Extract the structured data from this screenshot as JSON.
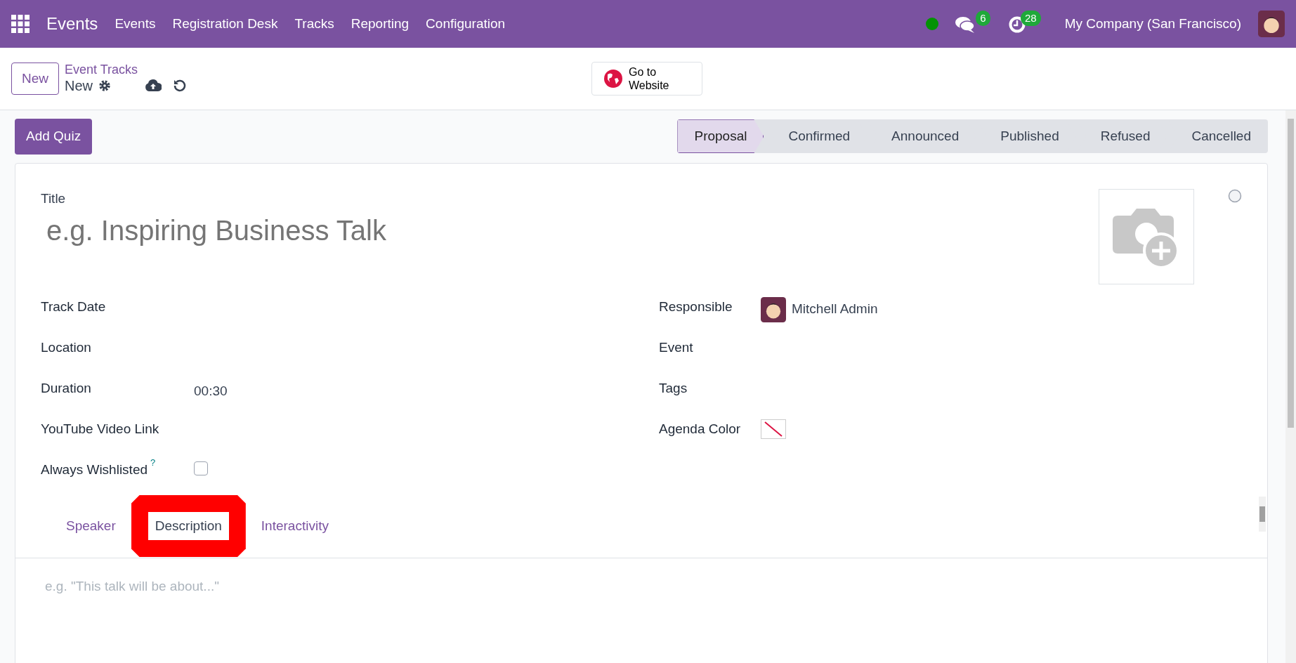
{
  "navbar": {
    "app_name": "Events",
    "menu": [
      "Events",
      "Registration Desk",
      "Tracks",
      "Reporting",
      "Configuration"
    ],
    "messages_count": "6",
    "activities_count": "28",
    "company": "My Company (San Francisco)"
  },
  "control_panel": {
    "new_button": "New",
    "breadcrumb": "Event Tracks",
    "record": "New",
    "website_button": "Go to Website"
  },
  "action_button": "Add Quiz",
  "stages": [
    {
      "label": "Proposal",
      "selected": true
    },
    {
      "label": "Confirmed",
      "selected": false
    },
    {
      "label": "Announced",
      "selected": false
    },
    {
      "label": "Published",
      "selected": false
    },
    {
      "label": "Refused",
      "selected": false
    },
    {
      "label": "Cancelled",
      "selected": false
    }
  ],
  "form": {
    "title_label": "Title",
    "title_placeholder": "e.g. Inspiring Business Talk",
    "left_fields": [
      {
        "label": "Track Date",
        "kind": "text"
      },
      {
        "label": "Location",
        "kind": "text"
      },
      {
        "label": "Duration",
        "kind": "text",
        "value": "00:30"
      },
      {
        "label": "YouTube Video Link",
        "kind": "text"
      },
      {
        "label": "Always Wishlisted",
        "kind": "checkbox",
        "help": "?",
        "checked": false
      }
    ],
    "right_fields": [
      {
        "label": "Responsible",
        "kind": "user",
        "value": "Mitchell Admin"
      },
      {
        "label": "Event",
        "kind": "text"
      },
      {
        "label": "Tags",
        "kind": "text"
      },
      {
        "label": "Agenda Color",
        "kind": "color"
      }
    ]
  },
  "tabs": [
    {
      "label": "Speaker",
      "selected": false,
      "highlighted": false
    },
    {
      "label": "Description",
      "selected": true,
      "highlighted": true
    },
    {
      "label": "Interactivity",
      "selected": false,
      "highlighted": false
    }
  ],
  "description_placeholder": "e.g. \"This talk will be about...\""
}
